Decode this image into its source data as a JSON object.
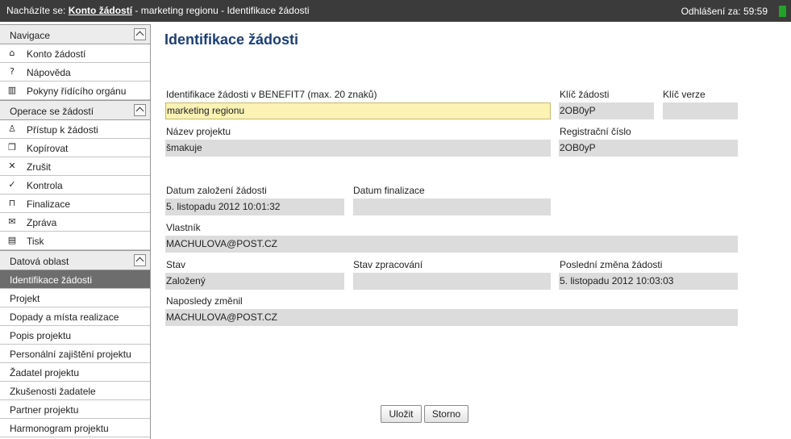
{
  "topbar": {
    "breadcrumb_prefix": "Nacházíte se:",
    "breadcrumb_link": "Konto žádostí",
    "breadcrumb_rest": "- marketing regionu - Identifikace žádosti",
    "session_label": "Odhlášení za:",
    "session_time": "59:59",
    "indicator_color": "#22a322"
  },
  "sidebar": {
    "navigace": {
      "title": "Navigace",
      "items": [
        {
          "label": "Konto žádostí",
          "icon": "home-icon"
        },
        {
          "label": "Nápověda",
          "icon": "help-icon"
        },
        {
          "label": "Pokyny řídícího orgánu",
          "icon": "book-icon"
        }
      ]
    },
    "operace": {
      "title": "Operace se žádostí",
      "items": [
        {
          "label": "Přístup k žádosti",
          "icon": "user-icon"
        },
        {
          "label": "Kopírovat",
          "icon": "copy-icon"
        },
        {
          "label": "Zrušit",
          "icon": "cross-icon"
        },
        {
          "label": "Kontrola",
          "icon": "check-icon"
        },
        {
          "label": "Finalizace",
          "icon": "lock-icon"
        },
        {
          "label": "Zpráva",
          "icon": "envelope-icon"
        },
        {
          "label": "Tisk",
          "icon": "print-icon"
        }
      ]
    },
    "datova": {
      "title": "Datová oblast",
      "items": [
        {
          "label": "Identifikace žádosti"
        },
        {
          "label": "Projekt"
        },
        {
          "label": "Dopady a místa realizace"
        },
        {
          "label": "Popis projektu"
        },
        {
          "label": "Personální zajištění projektu"
        },
        {
          "label": "Žadatel projektu"
        },
        {
          "label": "Zkušenosti žadatele"
        },
        {
          "label": "Partner projektu"
        },
        {
          "label": "Harmonogram projektu"
        }
      ]
    }
  },
  "main": {
    "title": "Identifikace žádosti",
    "fields": {
      "identifikace": {
        "label": "Identifikace žádosti v BENEFIT7 (max. 20 znaků)",
        "value": "marketing regionu"
      },
      "klic_zadosti": {
        "label": "Klíč žádosti",
        "value": "2OB0yP"
      },
      "klic_verze": {
        "label": "Klíč verze",
        "value": ""
      },
      "nazev": {
        "label": "Název projektu",
        "value": "šmakuje"
      },
      "registracni": {
        "label": "Registrační číslo",
        "value": "2OB0yP"
      },
      "datum_zalozeni": {
        "label": "Datum založení žádosti",
        "value": "5. listopadu 2012 10:01:32"
      },
      "datum_finalizace": {
        "label": "Datum finalizace",
        "value": ""
      },
      "vlastnik": {
        "label": "Vlastník",
        "value": "MACHULOVA@POST.CZ"
      },
      "stav": {
        "label": "Stav",
        "value": "Založený"
      },
      "stav_zpracovani": {
        "label": "Stav zpracování",
        "value": ""
      },
      "posledni_zmena": {
        "label": "Poslední změna žádosti",
        "value": "5. listopadu 2012 10:03:03"
      },
      "naposledy": {
        "label": "Naposledy změnil",
        "value": "MACHULOVA@POST.CZ"
      }
    },
    "buttons": {
      "save": "Uložit",
      "cancel": "Storno"
    }
  },
  "colors": {
    "title": "#1d3f72",
    "topbar": "#3b3b3b",
    "field_bg": "#dcdcdc",
    "editable_bg": "#fbf2b3",
    "active_item": "#6d6d6d"
  }
}
